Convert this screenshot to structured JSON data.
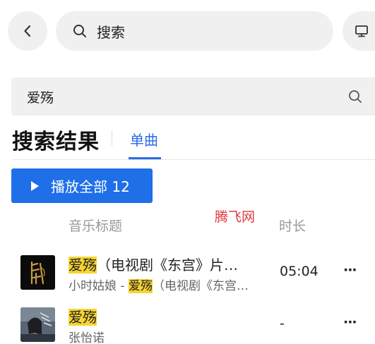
{
  "topbar": {
    "search_label": "搜索"
  },
  "query": {
    "value": "爱殇"
  },
  "results": {
    "title": "搜索结果",
    "tabs": [
      {
        "label": "单曲",
        "active": true
      }
    ],
    "play_all_label": "播放全部 12"
  },
  "table": {
    "col_title": "音乐标题",
    "col_duration": "时长",
    "watermark": "腾飞网"
  },
  "songs": [
    {
      "title_hl": "爱殇",
      "title_rest": "（电视剧《东宫》片…",
      "artist": "小时姑娘",
      "sep": " - ",
      "sub_hl": "爱殇",
      "sub_rest": "（电视剧《东宫…",
      "duration": "05:04",
      "more": "···"
    },
    {
      "title_hl": "爱殇",
      "title_rest": "",
      "artist": "张怡诺",
      "sep": "",
      "sub_hl": "",
      "sub_rest": "",
      "duration": "-",
      "more": "···"
    }
  ],
  "colors": {
    "accent": "#1f6fe8",
    "highlight": "#f7d432",
    "watermark": "#e0393e"
  }
}
